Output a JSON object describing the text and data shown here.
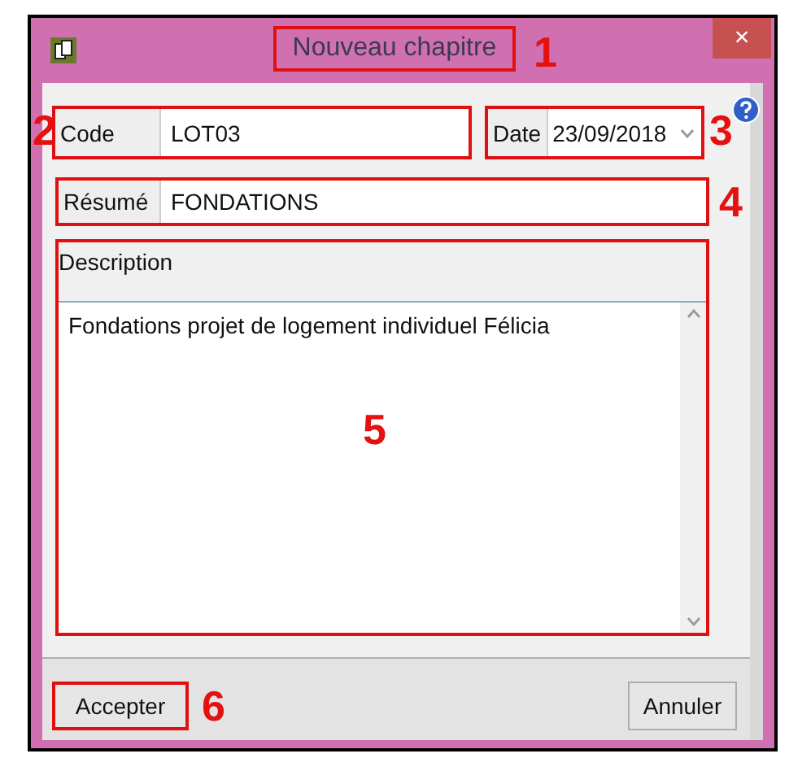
{
  "window": {
    "title": "Nouveau chapitre",
    "close": "×"
  },
  "fields": {
    "code": {
      "label": "Code",
      "value": "LOT03"
    },
    "date": {
      "label": "Date",
      "value": "23/09/2018"
    },
    "resume": {
      "label": "Résumé",
      "value": "FONDATIONS"
    }
  },
  "description": {
    "label": "Description",
    "value": "Fondations projet de logement individuel Félicia"
  },
  "buttons": [
    {
      "label": "Accepter",
      "kind": "primary"
    },
    {
      "label": "Annuler",
      "kind": "secondary"
    }
  ],
  "callouts": [
    "1",
    "2",
    "3",
    "4",
    "5",
    "6"
  ]
}
